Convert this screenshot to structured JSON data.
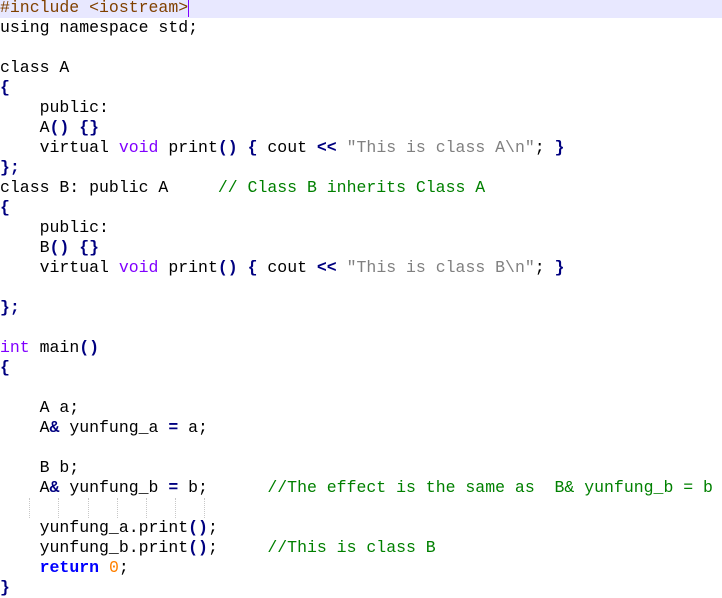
{
  "editor": {
    "colors": {
      "preprocessor": "#804000",
      "keyword": "#8000ff",
      "operator": "#000080",
      "string": "#808080",
      "comment": "#008000",
      "number": "#ff8000",
      "instruction": "#0000ff",
      "current_line": "#e8e8ff"
    },
    "current_line": 1,
    "lines": [
      [
        [
          "#include <iostream>",
          "pre"
        ]
      ],
      [
        [
          "using namespace std;",
          ""
        ]
      ],
      [],
      [
        [
          "class A",
          ""
        ]
      ],
      [
        [
          "{",
          "op"
        ]
      ],
      [
        [
          "    public:",
          ""
        ]
      ],
      [
        [
          "    A",
          ""
        ],
        [
          "()",
          "op"
        ],
        [
          " ",
          ""
        ],
        [
          "{}",
          "op"
        ]
      ],
      [
        [
          "    virtual ",
          ""
        ],
        [
          "void",
          "kw"
        ],
        [
          " print",
          ""
        ],
        [
          "()",
          "op"
        ],
        [
          " ",
          ""
        ],
        [
          "{",
          "op"
        ],
        [
          " cout ",
          ""
        ],
        [
          "<<",
          "op"
        ],
        [
          " ",
          ""
        ],
        [
          "\"This is class A\\n\"",
          "str"
        ],
        [
          "; ",
          ""
        ],
        [
          "}",
          "op"
        ]
      ],
      [
        [
          "};",
          "op"
        ]
      ],
      [
        [
          "class B: public A     ",
          ""
        ],
        [
          "// Class B inherits Class A",
          "cm"
        ]
      ],
      [
        [
          "{",
          "op"
        ]
      ],
      [
        [
          "    public:",
          ""
        ]
      ],
      [
        [
          "    B",
          ""
        ],
        [
          "()",
          "op"
        ],
        [
          " ",
          ""
        ],
        [
          "{}",
          "op"
        ]
      ],
      [
        [
          "    virtual ",
          ""
        ],
        [
          "void",
          "kw"
        ],
        [
          " print",
          ""
        ],
        [
          "()",
          "op"
        ],
        [
          " ",
          ""
        ],
        [
          "{",
          "op"
        ],
        [
          " cout ",
          ""
        ],
        [
          "<<",
          "op"
        ],
        [
          " ",
          ""
        ],
        [
          "\"This is class B\\n\"",
          "str"
        ],
        [
          "; ",
          ""
        ],
        [
          "}",
          "op"
        ]
      ],
      [],
      [
        [
          "};",
          "op"
        ]
      ],
      [],
      [
        [
          "int",
          "kw"
        ],
        [
          " main",
          ""
        ],
        [
          "()",
          "op"
        ]
      ],
      [
        [
          "{",
          "op"
        ]
      ],
      [],
      [
        [
          "    A a;",
          ""
        ]
      ],
      [
        [
          "    A",
          ""
        ],
        [
          "&",
          "op"
        ],
        [
          " yunfung_a ",
          ""
        ],
        [
          "=",
          "op"
        ],
        [
          " a;",
          ""
        ]
      ],
      [],
      [
        [
          "    B b;",
          ""
        ]
      ],
      [
        [
          "    A",
          ""
        ],
        [
          "&",
          "op"
        ],
        [
          " yunfung_b ",
          ""
        ],
        [
          "=",
          "op"
        ],
        [
          " b;      ",
          ""
        ],
        [
          "//The effect is the same as  B& yunfung_b = b",
          "cm"
        ]
      ],
      [],
      [
        [
          "    yunfung_a.print",
          ""
        ],
        [
          "()",
          "op"
        ],
        [
          ";",
          ""
        ]
      ],
      [
        [
          "    yunfung_b.print",
          ""
        ],
        [
          "()",
          "op"
        ],
        [
          ";     ",
          ""
        ],
        [
          "//This is class B",
          "cm"
        ]
      ],
      [
        [
          "    ",
          ""
        ],
        [
          "return",
          "kwb"
        ],
        [
          " ",
          ""
        ],
        [
          "0",
          "num"
        ],
        [
          ";",
          ""
        ]
      ],
      [
        [
          "}",
          "op"
        ]
      ]
    ]
  }
}
